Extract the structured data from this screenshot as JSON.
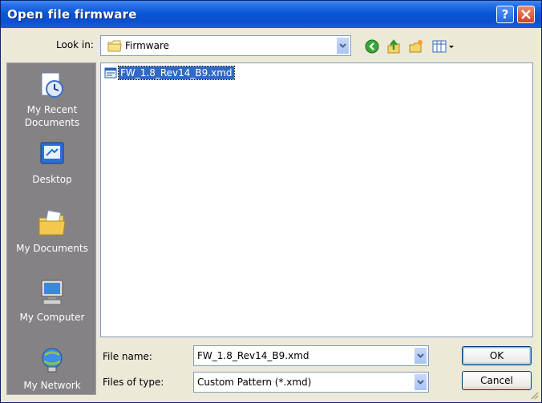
{
  "window": {
    "title": "Open file firmware"
  },
  "toolbar": {
    "look_in_label": "Look in:",
    "look_in_value": "Firmware",
    "icons": [
      "back-icon",
      "up-folder-icon",
      "new-folder-icon",
      "view-menu-icon"
    ]
  },
  "places": [
    {
      "label": "My Recent Documents",
      "icon": "recent-documents-icon"
    },
    {
      "label": "Desktop",
      "icon": "desktop-icon"
    },
    {
      "label": "My Documents",
      "icon": "my-documents-icon"
    },
    {
      "label": "My Computer",
      "icon": "my-computer-icon"
    },
    {
      "label": "My Network",
      "icon": "my-network-icon"
    }
  ],
  "files": [
    {
      "name": "FW_1.8_Rev14_B9.xmd",
      "selected": true
    }
  ],
  "form": {
    "file_name_label": "File name:",
    "file_name_value": "FW_1.8_Rev14_B9.xmd",
    "file_type_label": "Files of type:",
    "file_type_value": "Custom Pattern (*.xmd)"
  },
  "buttons": {
    "ok": "OK",
    "cancel": "Cancel"
  },
  "colors": {
    "titlebar": "#0b4fd0",
    "selection": "#316ac5",
    "places_bg": "#848284"
  }
}
